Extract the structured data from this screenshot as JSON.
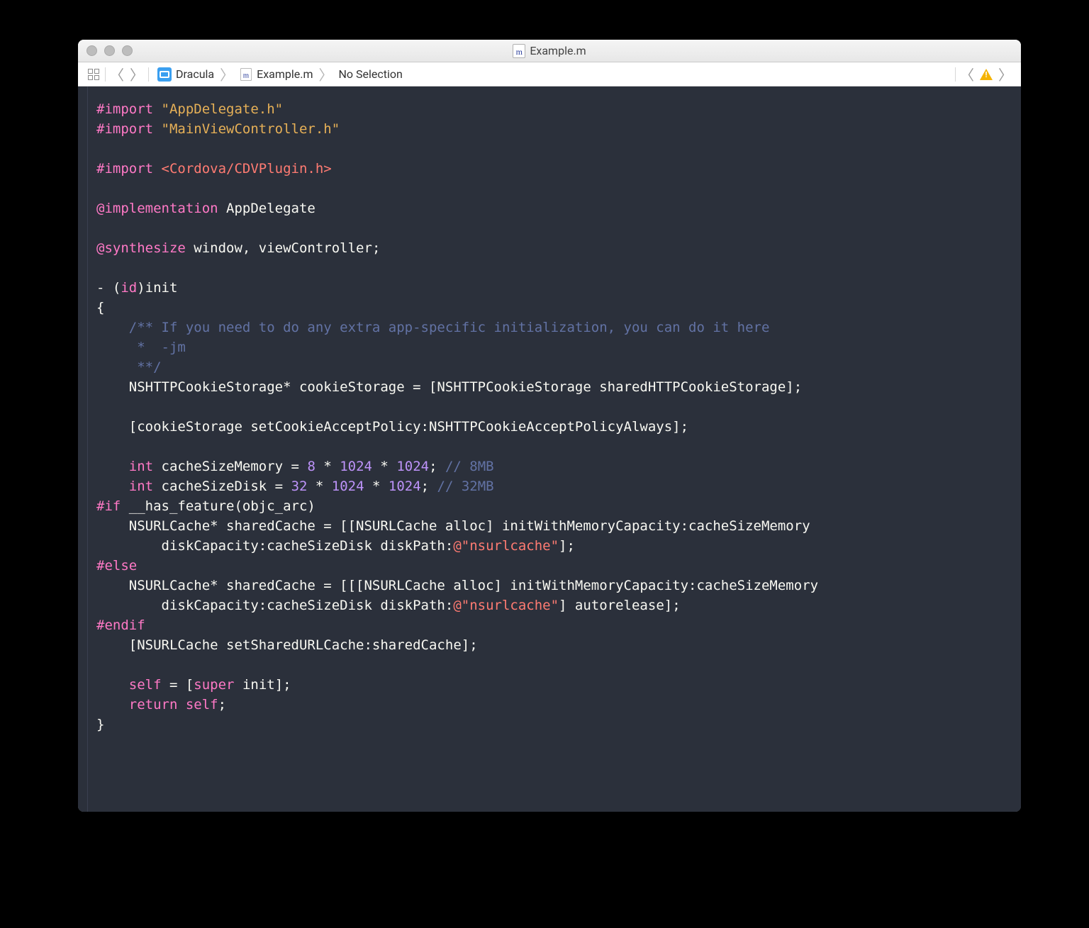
{
  "window": {
    "title": "Example.m"
  },
  "jumpbar": {
    "project": "Dracula",
    "file": "Example.m",
    "selection": "No Selection"
  },
  "colors": {
    "bg": "#2b303b",
    "keyword": "#ff79c6",
    "string": "#ff7b72",
    "stringQuote": "#e6b057",
    "number": "#bd93f9",
    "comment": "#6272a4",
    "text": "#cfd2da"
  },
  "code": {
    "lines": [
      [
        [
          "pre",
          "#import"
        ],
        [
          "",
          ""
        ],
        [
          "strq",
          " \"AppDelegate.h\""
        ]
      ],
      [
        [
          "pre",
          "#import"
        ],
        [
          "",
          ""
        ],
        [
          "strq",
          " \"MainViewController.h\""
        ]
      ],
      [
        [
          "",
          ""
        ]
      ],
      [
        [
          "pre",
          "#import"
        ],
        [
          "",
          ""
        ],
        [
          "str",
          " <Cordova/CDVPlugin.h>"
        ]
      ],
      [
        [
          "",
          ""
        ]
      ],
      [
        [
          "kw",
          "@implementation"
        ],
        [
          "",
          " AppDelegate"
        ]
      ],
      [
        [
          "",
          ""
        ]
      ],
      [
        [
          "kw",
          "@synthesize"
        ],
        [
          "",
          " window, viewController;"
        ]
      ],
      [
        [
          "",
          ""
        ]
      ],
      [
        [
          "",
          "- ("
        ],
        [
          "kw",
          "id"
        ],
        [
          "",
          ")init"
        ]
      ],
      [
        [
          "",
          "{"
        ]
      ],
      [
        [
          "cmt",
          "    /** If you need to do any extra app-specific initialization, you can do it here"
        ]
      ],
      [
        [
          "cmt",
          "     *  -jm"
        ]
      ],
      [
        [
          "cmt",
          "     **/"
        ]
      ],
      [
        [
          "",
          "    NSHTTPCookieStorage* cookieStorage = [NSHTTPCookieStorage sharedHTTPCookieStorage];"
        ]
      ],
      [
        [
          "",
          ""
        ]
      ],
      [
        [
          "",
          "    [cookieStorage setCookieAcceptPolicy:NSHTTPCookieAcceptPolicyAlways];"
        ]
      ],
      [
        [
          "",
          ""
        ]
      ],
      [
        [
          "",
          "    "
        ],
        [
          "kw",
          "int"
        ],
        [
          "",
          " cacheSizeMemory = "
        ],
        [
          "num",
          "8"
        ],
        [
          "",
          " * "
        ],
        [
          "num",
          "1024"
        ],
        [
          "",
          " * "
        ],
        [
          "num",
          "1024"
        ],
        [
          "",
          "; "
        ],
        [
          "cmt",
          "// 8MB"
        ]
      ],
      [
        [
          "",
          "    "
        ],
        [
          "kw",
          "int"
        ],
        [
          "",
          " cacheSizeDisk = "
        ],
        [
          "num",
          "32"
        ],
        [
          "",
          " * "
        ],
        [
          "num",
          "1024"
        ],
        [
          "",
          " * "
        ],
        [
          "num",
          "1024"
        ],
        [
          "",
          "; "
        ],
        [
          "cmt",
          "// 32MB"
        ]
      ],
      [
        [
          "pre",
          "#if"
        ],
        [
          "",
          " __has_feature(objc_arc)"
        ]
      ],
      [
        [
          "",
          "    NSURLCache* sharedCache = [[NSURLCache alloc] initWithMemoryCapacity:cacheSizeMemory"
        ]
      ],
      [
        [
          "",
          "        diskCapacity:cacheSizeDisk diskPath:"
        ],
        [
          "str",
          "@\"nsurlcache\""
        ],
        [
          "",
          "];"
        ]
      ],
      [
        [
          "pre",
          "#else"
        ]
      ],
      [
        [
          "",
          "    NSURLCache* sharedCache = [[[NSURLCache alloc] initWithMemoryCapacity:cacheSizeMemory"
        ]
      ],
      [
        [
          "",
          "        diskCapacity:cacheSizeDisk diskPath:"
        ],
        [
          "str",
          "@\"nsurlcache\""
        ],
        [
          "",
          "] autorelease];"
        ]
      ],
      [
        [
          "pre",
          "#endif"
        ]
      ],
      [
        [
          "",
          "    [NSURLCache setSharedURLCache:sharedCache];"
        ]
      ],
      [
        [
          "",
          ""
        ]
      ],
      [
        [
          "",
          "    "
        ],
        [
          "kw",
          "self"
        ],
        [
          "",
          " = ["
        ],
        [
          "kw",
          "super"
        ],
        [
          "",
          " init];"
        ]
      ],
      [
        [
          "",
          "    "
        ],
        [
          "kw",
          "return"
        ],
        [
          "",
          " "
        ],
        [
          "kw",
          "self"
        ],
        [
          "",
          ";"
        ]
      ],
      [
        [
          "",
          "}"
        ]
      ]
    ]
  }
}
